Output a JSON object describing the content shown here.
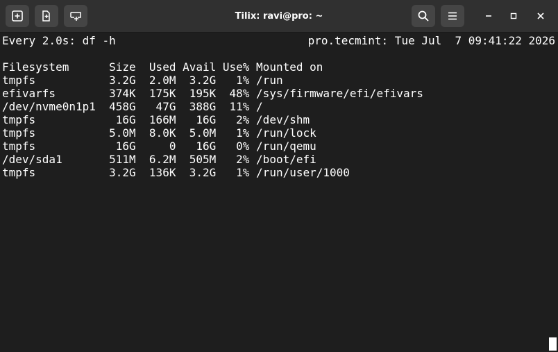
{
  "window": {
    "title": "Tilix: ravi@pro: ~"
  },
  "toolbar": {
    "buttons": [
      {
        "name": "add-terminal-button",
        "icon": "plus-box-icon"
      },
      {
        "name": "split-terminal-button",
        "icon": "split-add-icon"
      },
      {
        "name": "add-session-button",
        "icon": "add-tab-icon"
      }
    ],
    "search_icon": "search-icon",
    "menu_icon": "hamburger-menu-icon"
  },
  "window_controls": {
    "minimize_icon": "minimize-icon",
    "maximize_icon": "maximize-icon",
    "close_icon": "close-icon"
  },
  "terminal": {
    "watch_header": "Every 2.0s: df -h",
    "host_time": "pro.tecmint: Tue Jul  7 09:41:22 2026",
    "lines": [
      "Filesystem      Size  Used Avail Use% Mounted on",
      "tmpfs           3.2G  2.0M  3.2G   1% /run",
      "efivarfs        374K  175K  195K  48% /sys/firmware/efi/efivars",
      "/dev/nvme0n1p1  458G   47G  388G  11% /",
      "tmpfs            16G  166M   16G   2% /dev/shm",
      "tmpfs           5.0M  8.0K  5.0M   1% /run/lock",
      "tmpfs            16G     0   16G   0% /run/qemu",
      "/dev/sda1       511M  6.2M  505M   2% /boot/efi",
      "tmpfs           3.2G  136K  3.2G   1% /run/user/1000"
    ]
  },
  "colors": {
    "titlebar": "#303030",
    "button": "#454545",
    "background": "#1e1e1e",
    "foreground": "#ffffff"
  }
}
